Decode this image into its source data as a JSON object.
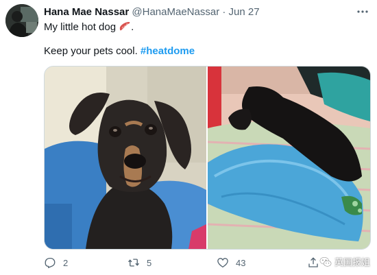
{
  "user": {
    "display_name": "Hana Mae Nassar",
    "handle": "@HanaMaeNassar",
    "separator": "·",
    "date": "Jun 27"
  },
  "tweet": {
    "line1": "My little hot dog",
    "line1_suffix": ".",
    "line2_prefix": "Keep your pets cool. ",
    "hashtag": "#heatdome"
  },
  "icons": {
    "more": "more-options-icon",
    "line1_emoji": "sausage-emoji-icon",
    "reply": "reply-icon",
    "retweet": "retweet-icon",
    "like": "heart-icon",
    "share": "share-icon"
  },
  "actions": {
    "reply_count": "2",
    "retweet_count": "5",
    "like_count": "43"
  },
  "watermark": {
    "text": "英国报姐"
  },
  "colors": {
    "link": "#1d9bf0",
    "secondary_text": "#536471",
    "primary_text": "#0f1419"
  }
}
